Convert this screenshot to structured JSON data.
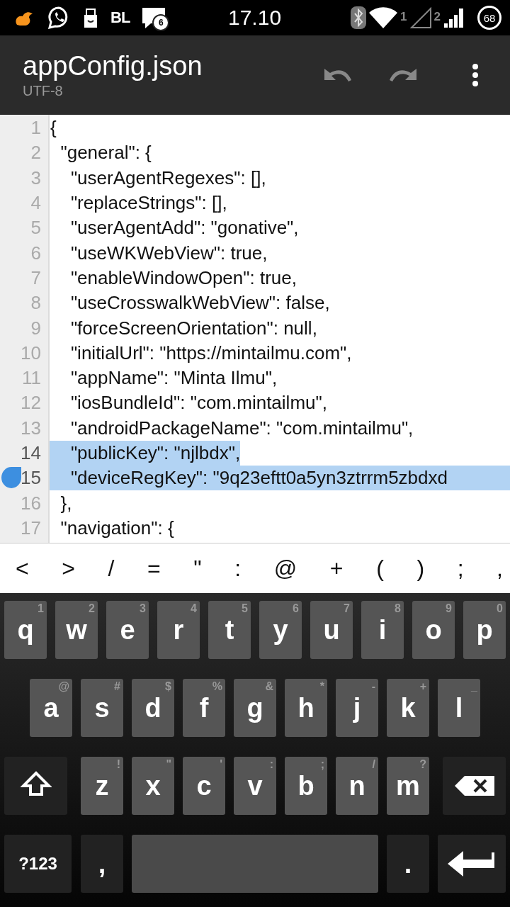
{
  "status_bar": {
    "badge_letters": "BL",
    "message_count": "6",
    "time": "17.10",
    "sim_1": "1",
    "sim_2": "2",
    "battery": "68"
  },
  "app_bar": {
    "title": "appConfig.json",
    "subtitle": "UTF-8"
  },
  "editor": {
    "lines": [
      {
        "number": "1",
        "text": "{",
        "selected": false
      },
      {
        "number": "2",
        "text": "  \"general\": {",
        "selected": false
      },
      {
        "number": "3",
        "text": "    \"userAgentRegexes\": [],",
        "selected": false
      },
      {
        "number": "4",
        "text": "    \"replaceStrings\": [],",
        "selected": false
      },
      {
        "number": "5",
        "text": "    \"userAgentAdd\": \"gonative\",",
        "selected": false
      },
      {
        "number": "6",
        "text": "    \"useWKWebView\": true,",
        "selected": false
      },
      {
        "number": "7",
        "text": "    \"enableWindowOpen\": true,",
        "selected": false
      },
      {
        "number": "8",
        "text": "    \"useCrosswalkWebView\": false,",
        "selected": false
      },
      {
        "number": "9",
        "text": "    \"forceScreenOrientation\": null,",
        "selected": false
      },
      {
        "number": "10",
        "text": "    \"initialUrl\": \"https://mintailmu.com\",",
        "selected": false
      },
      {
        "number": "11",
        "text": "    \"appName\": \"Minta Ilmu\",",
        "selected": false
      },
      {
        "number": "12",
        "text": "    \"iosBundleId\": \"com.mintailmu\",",
        "selected": false
      },
      {
        "number": "13",
        "text": "    \"androidPackageName\": \"com.mintailmu\",",
        "selected": false
      },
      {
        "number": "14",
        "text": "    \"publicKey\": \"njlbdx\",",
        "selected": true
      },
      {
        "number": "15",
        "text": "    \"deviceRegKey\": \"9q23eftt0a5yn3ztrrm5zbdxd",
        "selected": true
      },
      {
        "number": "16",
        "text": "  },",
        "selected": false
      },
      {
        "number": "17",
        "text": "  \"navigation\": {",
        "selected": false
      }
    ]
  },
  "symbol_bar": [
    "<",
    ">",
    "/",
    "=",
    "\"",
    ":",
    "@",
    "+",
    "(",
    ")",
    ";",
    ","
  ],
  "keyboard": {
    "rows": [
      {
        "keys": [
          {
            "kind": "letter",
            "label": "q",
            "hint": "1"
          },
          {
            "kind": "letter",
            "label": "w",
            "hint": "2"
          },
          {
            "kind": "letter",
            "label": "e",
            "hint": "3"
          },
          {
            "kind": "letter",
            "label": "r",
            "hint": "4"
          },
          {
            "kind": "letter",
            "label": "t",
            "hint": "5"
          },
          {
            "kind": "letter",
            "label": "y",
            "hint": "6"
          },
          {
            "kind": "letter",
            "label": "u",
            "hint": "7"
          },
          {
            "kind": "letter",
            "label": "i",
            "hint": "8"
          },
          {
            "kind": "letter",
            "label": "o",
            "hint": "9"
          },
          {
            "kind": "letter",
            "label": "p",
            "hint": "0"
          }
        ]
      },
      {
        "keys": [
          {
            "kind": "letter",
            "label": "a",
            "hint": "@"
          },
          {
            "kind": "letter",
            "label": "s",
            "hint": "#"
          },
          {
            "kind": "letter",
            "label": "d",
            "hint": "$"
          },
          {
            "kind": "letter",
            "label": "f",
            "hint": "%"
          },
          {
            "kind": "letter",
            "label": "g",
            "hint": "&"
          },
          {
            "kind": "letter",
            "label": "h",
            "hint": "*"
          },
          {
            "kind": "letter",
            "label": "j",
            "hint": "-"
          },
          {
            "kind": "letter",
            "label": "k",
            "hint": "+"
          },
          {
            "kind": "letter",
            "label": "l",
            "hint": "_"
          }
        ]
      },
      {
        "keys": [
          {
            "kind": "shift"
          },
          {
            "kind": "letter",
            "label": "z",
            "hint": "!"
          },
          {
            "kind": "letter",
            "label": "x",
            "hint": "\""
          },
          {
            "kind": "letter",
            "label": "c",
            "hint": "'"
          },
          {
            "kind": "letter",
            "label": "v",
            "hint": ":"
          },
          {
            "kind": "letter",
            "label": "b",
            "hint": ";"
          },
          {
            "kind": "letter",
            "label": "n",
            "hint": "/"
          },
          {
            "kind": "letter",
            "label": "m",
            "hint": "?"
          },
          {
            "kind": "backspace"
          }
        ]
      },
      {
        "keys": [
          {
            "kind": "symbols",
            "label": "?123"
          },
          {
            "kind": "punct",
            "label": ","
          },
          {
            "kind": "space"
          },
          {
            "kind": "punct",
            "label": "."
          },
          {
            "kind": "enter"
          }
        ]
      }
    ]
  }
}
